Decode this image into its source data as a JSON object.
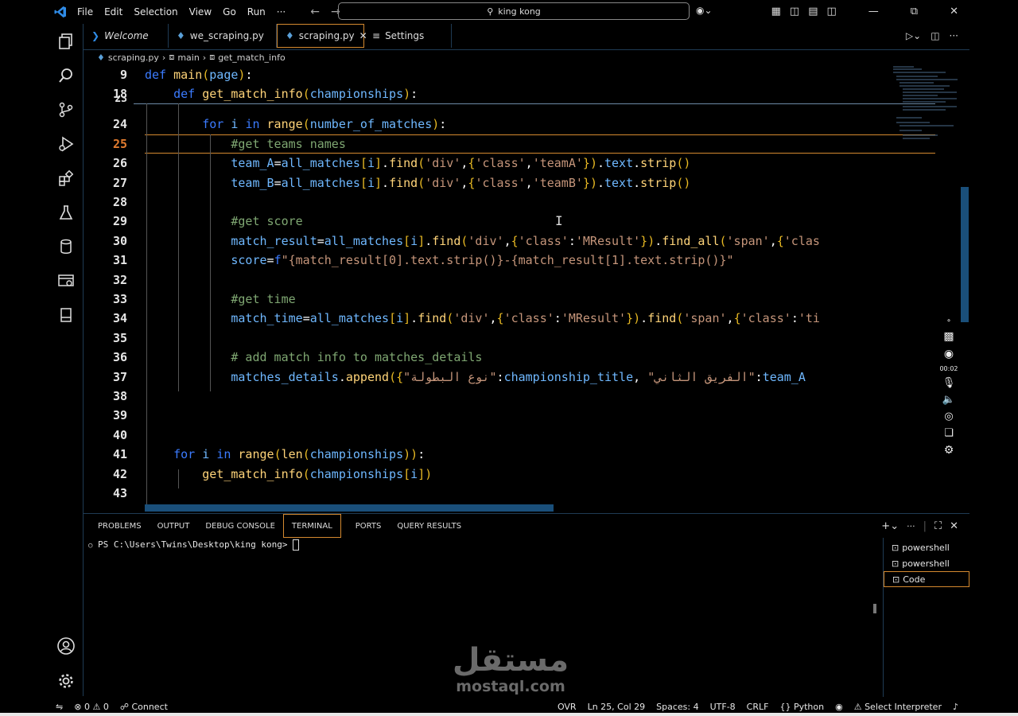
{
  "titlebar": {
    "menu": [
      "File",
      "Edit",
      "Selection",
      "View",
      "Go",
      "Run",
      "···"
    ],
    "search_text": "king kong"
  },
  "tabs": [
    {
      "label": "Welcome",
      "italic": true
    },
    {
      "label": "we_scraping.py"
    },
    {
      "label": "scraping.py",
      "active": true
    },
    {
      "label": "Settings"
    }
  ],
  "breadcrumb": [
    "scraping.py",
    "main",
    "get_match_info"
  ],
  "editor": {
    "current_line": "25",
    "sticky": [
      {
        "n": "9",
        "code": "def main(page):"
      },
      {
        "n": "18",
        "code": "    def get_match_info(championships):"
      }
    ],
    "lines": [
      {
        "n": "23",
        "code": ""
      },
      {
        "n": "24",
        "code": "        for i in range(number_of_matches):"
      },
      {
        "n": "25",
        "code": "            #get teams names"
      },
      {
        "n": "26",
        "code": "            team_A=all_matches[i].find('div',{'class','teamA'}).text.strip()"
      },
      {
        "n": "27",
        "code": "            team_B=all_matches[i].find('div',{'class','teamB'}).text.strip()"
      },
      {
        "n": "28",
        "code": ""
      },
      {
        "n": "29",
        "code": "            #get score"
      },
      {
        "n": "30",
        "code": "            match_result=all_matches[i].find('div',{'class':'MResult'}).find_all('span',{'clas"
      },
      {
        "n": "31",
        "code": "            score=f\"{match_result[0].text.strip()}-{match_result[1].text.strip()}\""
      },
      {
        "n": "32",
        "code": ""
      },
      {
        "n": "33",
        "code": "            #get time"
      },
      {
        "n": "34",
        "code": "            match_time=all_matches[i].find('div',{'class':'MResult'}).find('span',{'class':'ti"
      },
      {
        "n": "35",
        "code": ""
      },
      {
        "n": "36",
        "code": "            # add match info to matches_details"
      },
      {
        "n": "37",
        "code": "            matches_details.append({\"نوع البطولة\":championship_title, \"الفريق الثاني\":team_A"
      },
      {
        "n": "38",
        "code": ""
      },
      {
        "n": "39",
        "code": ""
      },
      {
        "n": "40",
        "code": ""
      },
      {
        "n": "41",
        "code": "    for i in range(len(championships)):"
      },
      {
        "n": "42",
        "code": "        get_match_info(championships[i])"
      },
      {
        "n": "43",
        "code": ""
      }
    ]
  },
  "recorder": {
    "time": "00:02"
  },
  "panel": {
    "tabs": [
      "PROBLEMS",
      "OUTPUT",
      "DEBUG CONSOLE",
      "TERMINAL",
      "PORTS",
      "QUERY RESULTS"
    ],
    "active_tab": "TERMINAL",
    "prompt": "PS C:\\Users\\Twins\\Desktop\\king kong> ",
    "terminals": [
      "powershell",
      "powershell",
      "Code"
    ]
  },
  "watermark": {
    "arabic": "مستقل",
    "latin": "mostaql.com"
  },
  "statusbar": {
    "errors": "0",
    "warnings": "0",
    "connect": "Connect",
    "ovr": "OVR",
    "position": "Ln 25, Col 29",
    "spaces": "Spaces: 4",
    "encoding": "UTF-8",
    "eol": "CRLF",
    "language": "Python",
    "interpreter": "Select Interpreter"
  },
  "colors": {
    "accent_border": "#d4892f",
    "keyword": "#3b7bff",
    "function": "#ffd479",
    "variable": "#6fb8ff",
    "string": "#c5957a",
    "comment": "#7fa772"
  }
}
